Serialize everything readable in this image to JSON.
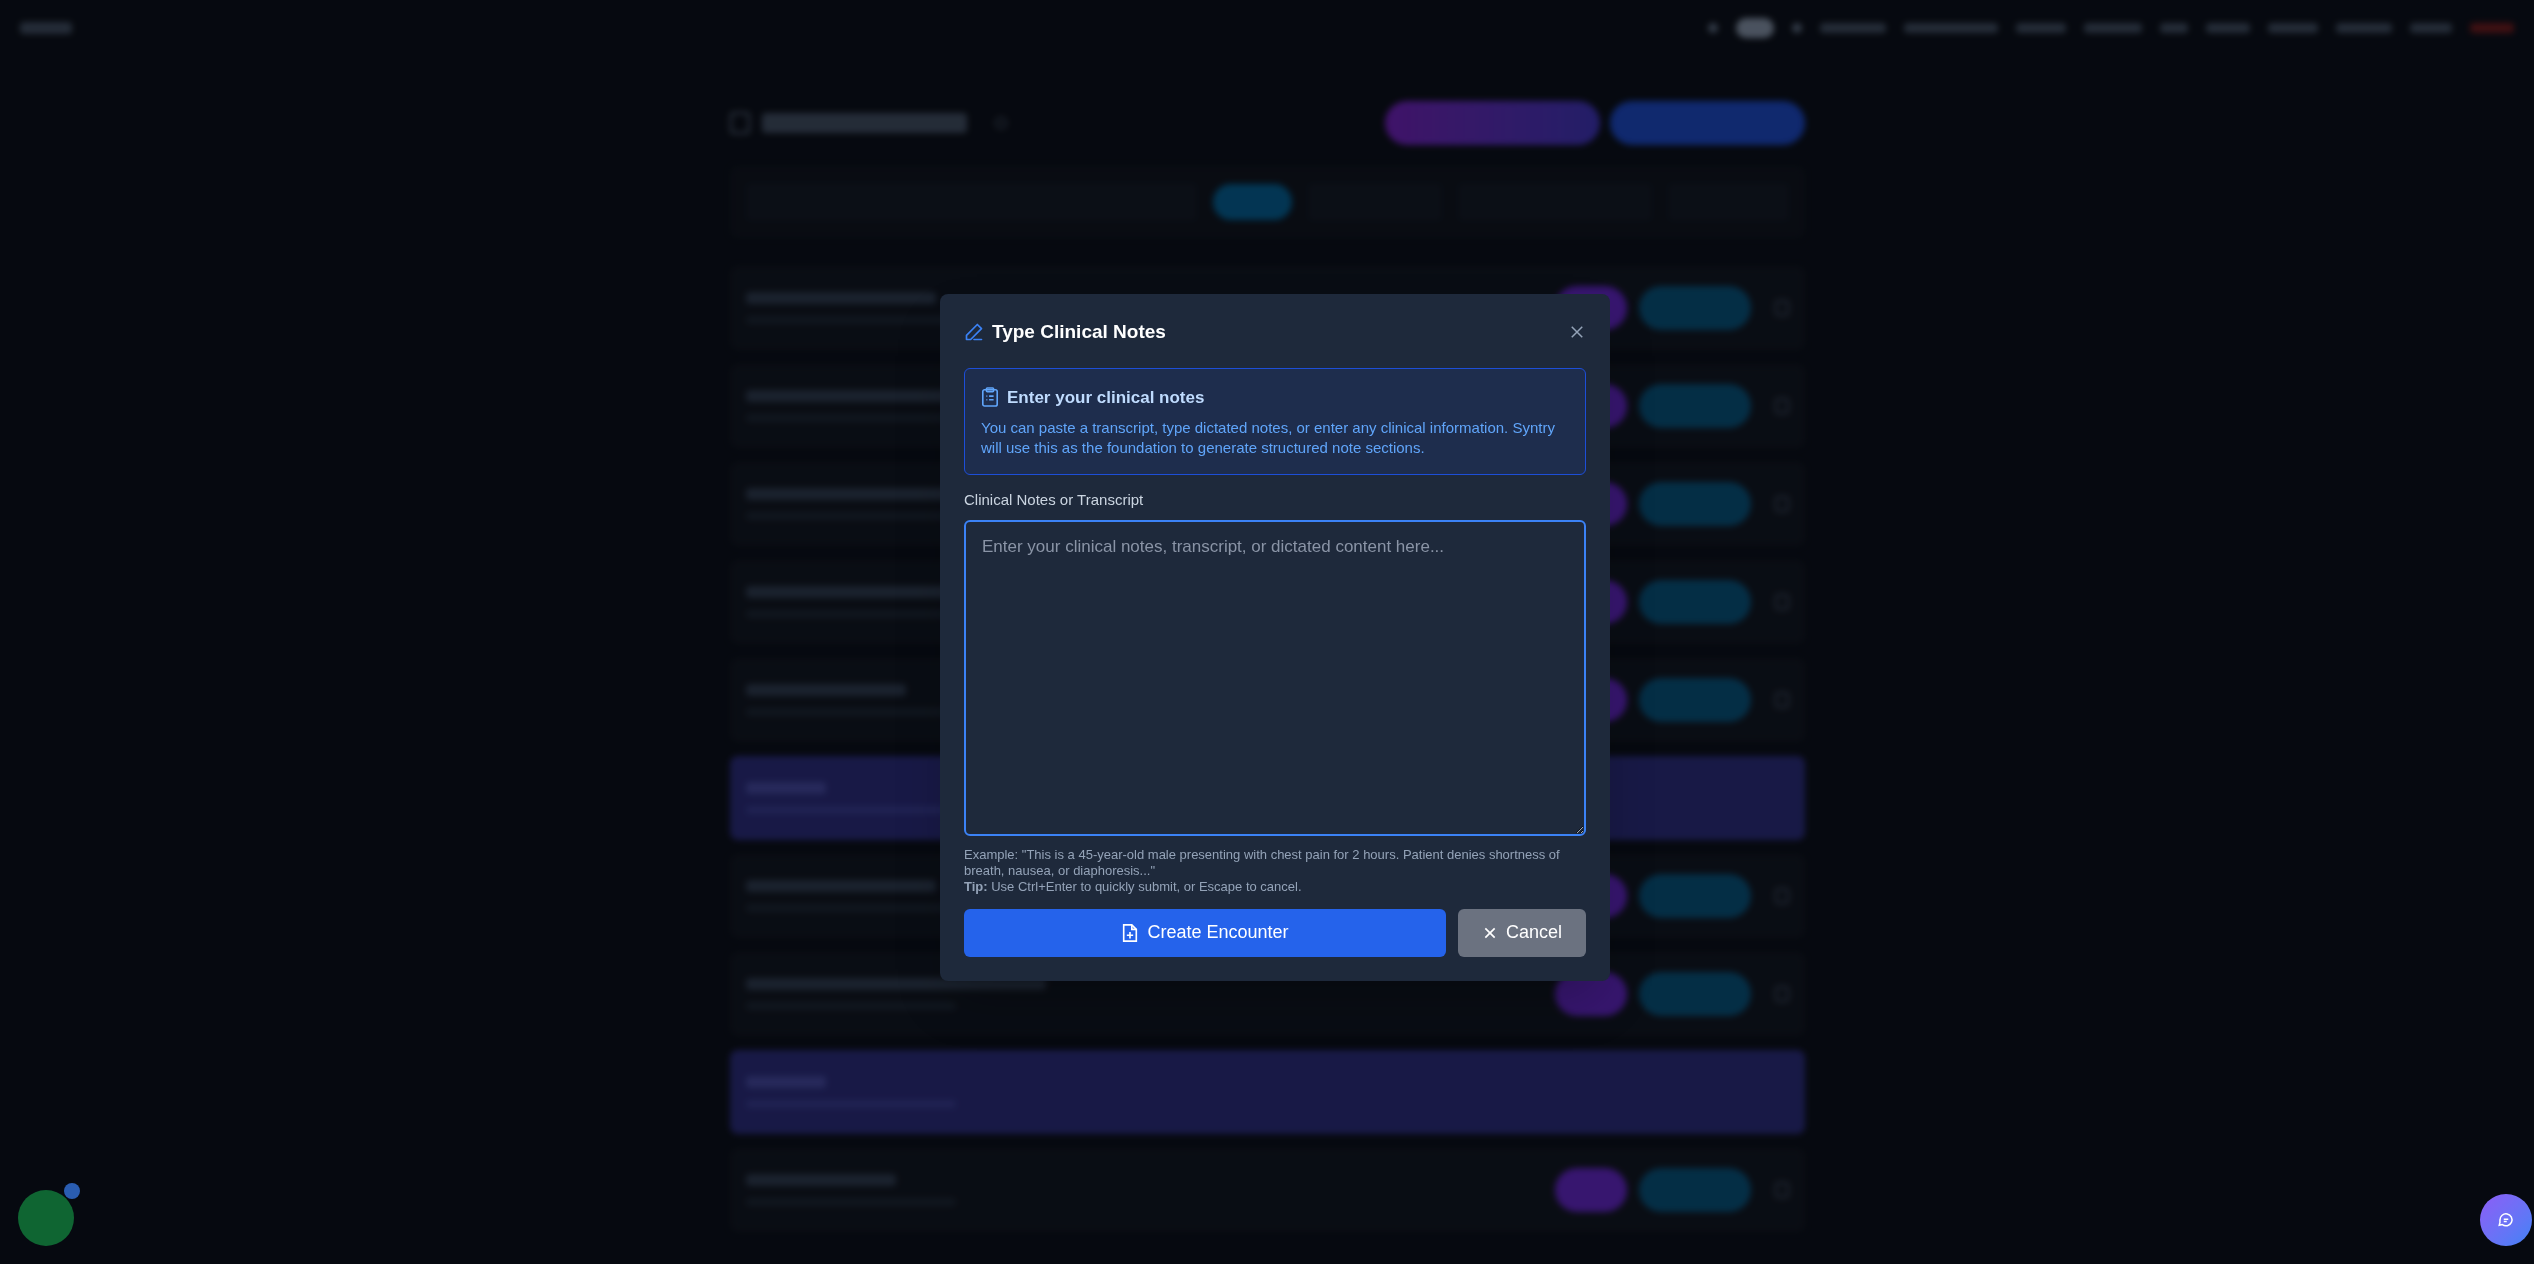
{
  "backdrop": {
    "rows": [
      {
        "highlighted": false
      },
      {
        "highlighted": false
      },
      {
        "highlighted": false
      },
      {
        "highlighted": false
      },
      {
        "highlighted": false
      },
      {
        "highlighted": true
      },
      {
        "highlighted": false
      },
      {
        "highlighted": false
      },
      {
        "highlighted": true
      },
      {
        "highlighted": false
      }
    ]
  },
  "modal": {
    "title": "Type Clinical Notes",
    "info_title": "Enter your clinical notes",
    "info_text": "You can paste a transcript, type dictated notes, or enter any clinical information. Syntry will use this as the foundation to generate structured note sections.",
    "field_label": "Clinical Notes or Transcript",
    "placeholder": "Enter your clinical notes, transcript, or dictated content here...",
    "example": "Example: \"This is a 45-year-old male presenting with chest pain for 2 hours. Patient denies shortness of breath, nausea, or diaphoresis...\"",
    "tip": "**Tip:** Use Ctrl+Enter to quickly submit, or Escape to cancel.",
    "buttons": [
      {
        "label": "Create Encounter",
        "kind": "primary"
      },
      {
        "label": "Cancel",
        "kind": "secondary"
      }
    ]
  }
}
